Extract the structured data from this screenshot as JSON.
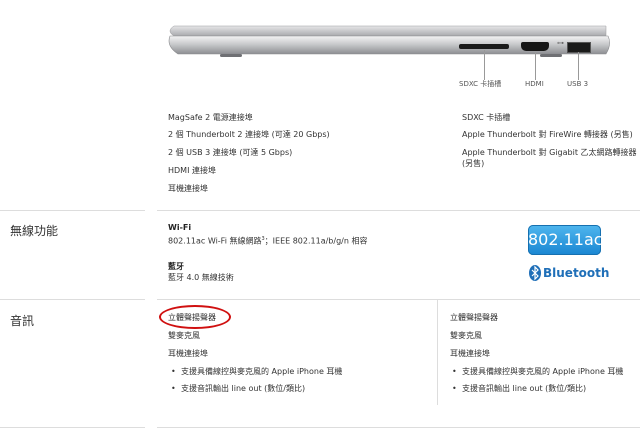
{
  "ports_figure": {
    "labels": {
      "sdxc": "SDXC 卡插槽",
      "hdmi": "HDMI",
      "usb3": "USB 3"
    }
  },
  "ports_list": {
    "left": [
      "MagSafe 2 電源連接埠",
      "2 個 Thunderbolt 2 連接埠 (可達 20 Gbps)",
      "2 個 USB 3 連接埠 (可達 5 Gbps)",
      "HDMI 連接埠",
      "耳機連接埠"
    ],
    "right": [
      "SDXC 卡插槽",
      "Apple Thunderbolt 對 FireWire 轉接器 (另售)",
      "Apple Thunderbolt 對 Gigabit 乙太網路轉接器",
      "(另售)"
    ]
  },
  "wireless": {
    "header": "無線功能",
    "wifi_title": "Wi-Fi",
    "wifi_desc_a": "802.11ac Wi-Fi 無線網路",
    "wifi_sup": "3",
    "wifi_desc_b": "；IEEE 802.11a/b/g/n 相容",
    "bt_title": "藍牙",
    "bt_desc": "藍牙 4.0 無線技術",
    "badge_80211ac": "802.11ac",
    "bluetooth_logo_text": "Bluetooth",
    "colors": {
      "badge_blue": "#1f8fd8",
      "bluetooth_blue": "#1f6fb8"
    }
  },
  "audio": {
    "header": "音訊",
    "left": {
      "item1": "立體聲揚聲器",
      "item2": "雙麥克風",
      "item3": "耳機連接埠",
      "bullet1": "支援具備線控與麥克風的 Apple iPhone 耳機",
      "bullet2": "支援音訊輸出 line out (數位/類比)"
    },
    "right": {
      "item1": "立體聲揚聲器",
      "item2": "雙麥克風",
      "item3": "耳機連接埠",
      "bullet1": "支援具備線控與麥克風的 Apple iPhone 耳機",
      "bullet2": "支援音訊輸出 line out (數位/類比)"
    },
    "highlight_color": "#d01010"
  }
}
